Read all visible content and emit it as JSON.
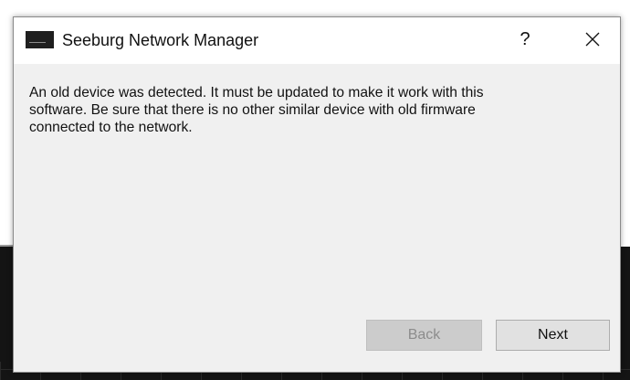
{
  "window": {
    "title": "Seeburg Network Manager",
    "help_label": "?",
    "close_icon": "close-icon",
    "app_icon": "seeburg-logo-icon"
  },
  "message": "An old device was detected. It must be updated to make it work with this\nsoftware. Be sure that there is no other similar device with old firmware\nconnected to the network.",
  "buttons": {
    "back_label": "Back",
    "back_enabled": false,
    "next_label": "Next",
    "next_enabled": true
  },
  "colors": {
    "dialog_bg": "#f0f0f0",
    "titlebar_bg": "#ffffff",
    "disabled_text": "#8c8c8c"
  }
}
